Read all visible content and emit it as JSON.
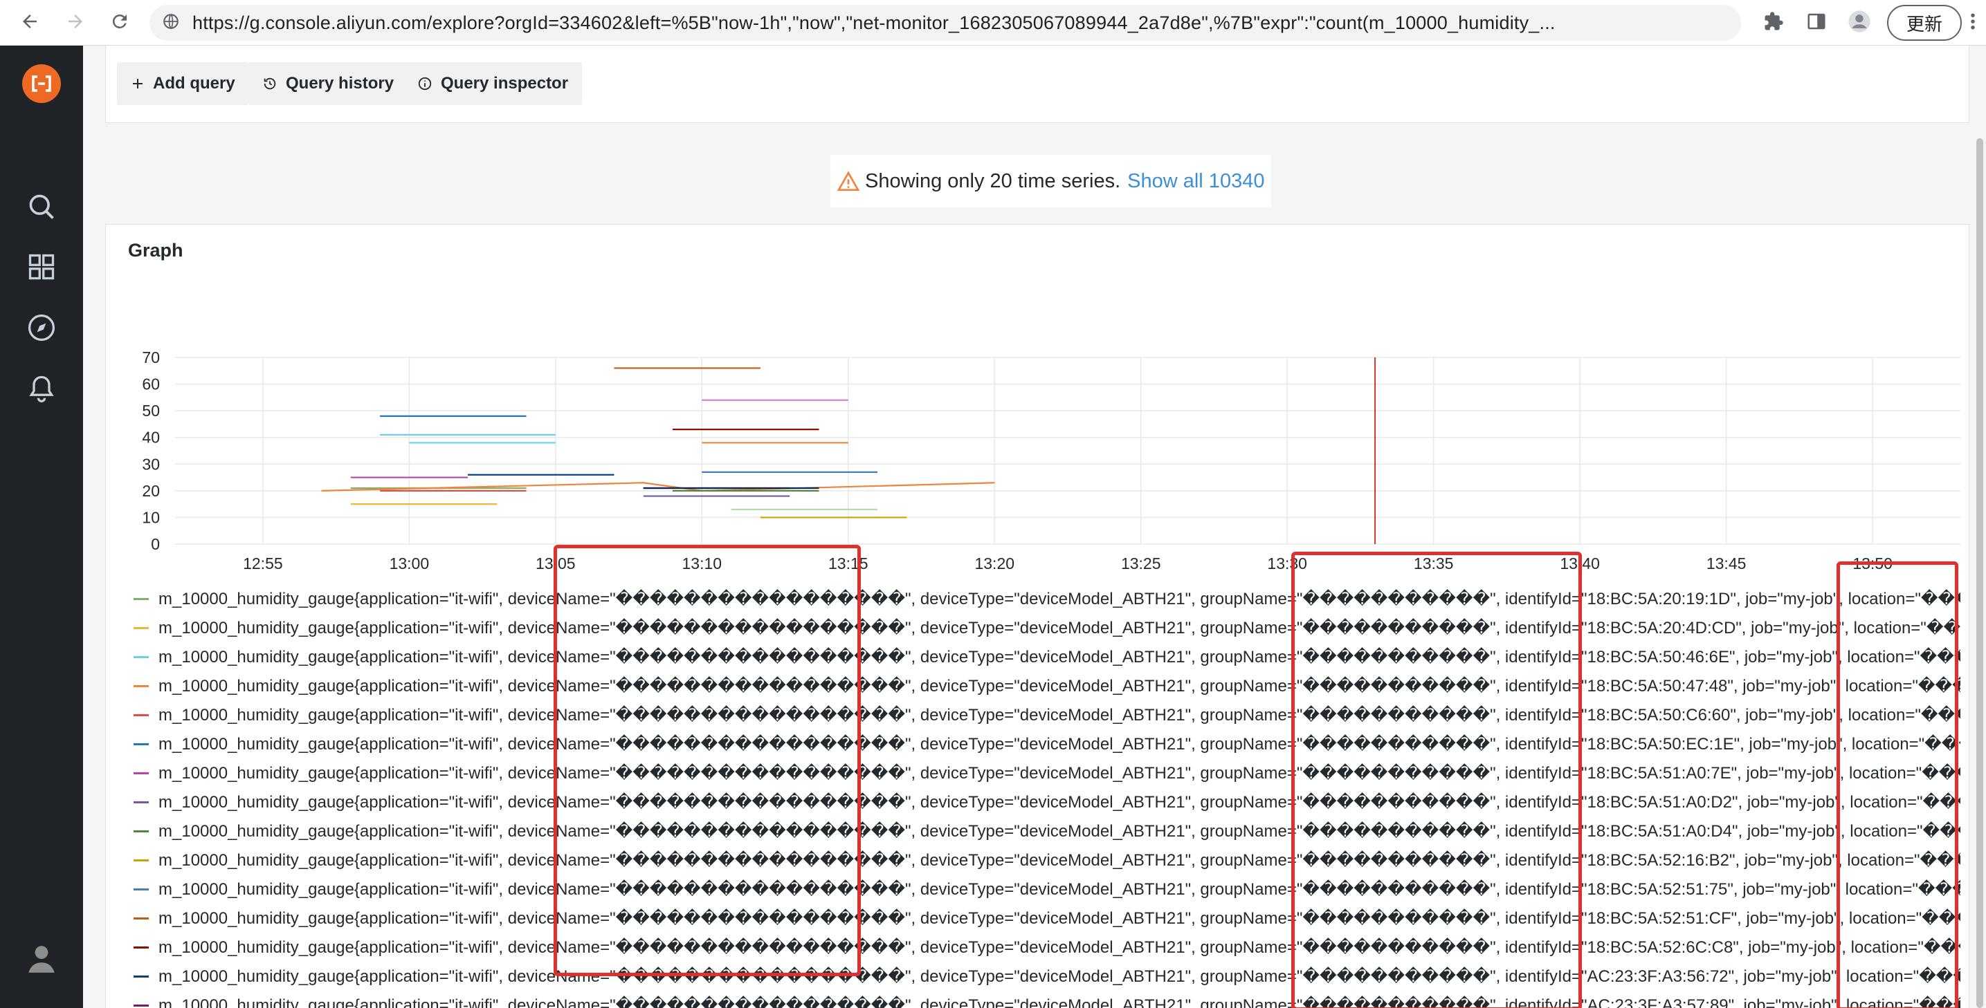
{
  "browser": {
    "url": "https://g.console.aliyun.com/explore?orgId=334602&left=%5B\"now-1h\",\"now\",\"net-monitor_1682305067089944_2a7d8e\",%7B\"expr\":\"count(m_10000_humidity_...",
    "update_label": "更新"
  },
  "toolbar": {
    "add_query": "Add query",
    "query_history": "Query history",
    "query_inspector": "Query inspector"
  },
  "warning": {
    "text": "Showing only 20 time series.",
    "link": "Show all 10340"
  },
  "panel": {
    "title": "Graph"
  },
  "colors": {
    "accent_red": "#e0302b",
    "link": "#3b8fd9",
    "sidebar_bg": "#1f2227",
    "logo": "#ee6a24"
  },
  "chart_data": {
    "type": "line",
    "xlabel": "",
    "ylabel": "",
    "ylim": [
      0,
      70
    ],
    "yticks": [
      "0",
      "10",
      "20",
      "30",
      "40",
      "50",
      "60",
      "70"
    ],
    "xlim": [
      "12:52",
      "13:53"
    ],
    "xticks": [
      "12:55",
      "13:00",
      "13:05",
      "13:10",
      "13:15",
      "13:20",
      "13:25",
      "13:30",
      "13:35",
      "13:40",
      "13:45",
      "13:50"
    ],
    "grid": true,
    "vertical_marker": {
      "x": "13:33",
      "color": "#c4392d"
    },
    "series": [
      {
        "color": "#7eb26d",
        "x": [
          "12:58",
          "13:04"
        ],
        "y": [
          21,
          21
        ]
      },
      {
        "color": "#eab839",
        "x": [
          "12:58",
          "13:03"
        ],
        "y": [
          15,
          15
        ]
      },
      {
        "color": "#6ed0e0",
        "x": [
          "12:59",
          "13:05"
        ],
        "y": [
          41,
          41
        ]
      },
      {
        "color": "#ef843c",
        "x": [
          "12:57",
          "13:08",
          "13:10",
          "13:20"
        ],
        "y": [
          20,
          23,
          20,
          23
        ]
      },
      {
        "color": "#e24d42",
        "x": [
          "12:59",
          "13:04"
        ],
        "y": [
          20,
          20
        ]
      },
      {
        "color": "#1f78c1",
        "x": [
          "12:59",
          "13:04"
        ],
        "y": [
          48,
          48
        ]
      },
      {
        "color": "#ba43a9",
        "x": [
          "12:58",
          "13:02"
        ],
        "y": [
          25,
          25
        ]
      },
      {
        "color": "#705da0",
        "x": [
          "13:08",
          "13:13"
        ],
        "y": [
          18,
          18
        ]
      },
      {
        "color": "#508642",
        "x": [
          "13:09",
          "13:14"
        ],
        "y": [
          20,
          20
        ]
      },
      {
        "color": "#cca300",
        "x": [
          "13:12",
          "13:17"
        ],
        "y": [
          10,
          10
        ]
      },
      {
        "color": "#447ebc",
        "x": [
          "13:10",
          "13:16"
        ],
        "y": [
          27,
          27
        ]
      },
      {
        "color": "#c15c17",
        "x": [
          "13:07",
          "13:12"
        ],
        "y": [
          66,
          66
        ]
      },
      {
        "color": "#890f02",
        "x": [
          "13:09",
          "13:14"
        ],
        "y": [
          43,
          43
        ]
      },
      {
        "color": "#0a437c",
        "x": [
          "13:02",
          "13:07"
        ],
        "y": [
          26,
          26
        ]
      },
      {
        "color": "#6d1f62",
        "x": [
          "13:08",
          "13:13"
        ],
        "y": [
          21,
          21
        ]
      },
      {
        "color": "#d683ce",
        "x": [
          "13:10",
          "13:15"
        ],
        "y": [
          54,
          54
        ]
      },
      {
        "color": "#ef843c",
        "x": [
          "13:10",
          "13:15"
        ],
        "y": [
          38,
          38
        ]
      },
      {
        "color": "#6ed0e0",
        "x": [
          "13:00",
          "13:05"
        ],
        "y": [
          38,
          38
        ]
      },
      {
        "color": "#b7dbab",
        "x": [
          "13:11",
          "13:16"
        ],
        "y": [
          13,
          13
        ]
      },
      {
        "color": "#052b51",
        "x": [
          "13:08",
          "13:14"
        ],
        "y": [
          21,
          21
        ]
      }
    ]
  },
  "legend": [
    {
      "color": "#7eb26d",
      "text": "m_10000_humidity_gauge{application=\"it-wifi\", deviceName=\"�����������������\", deviceType=\"deviceModel_ABTH21\", groupName=\"�����������\", identifyId=\"18:BC:5A:20:19:1D\", job=\"my-job\", location=\"���"
    },
    {
      "color": "#eab839",
      "text": "m_10000_humidity_gauge{application=\"it-wifi\", deviceName=\"�����������������\", deviceType=\"deviceModel_ABTH21\", groupName=\"�����������\", identifyId=\"18:BC:5A:20:4D:CD\", job=\"my-job\", location=\"���"
    },
    {
      "color": "#6ed0e0",
      "text": "m_10000_humidity_gauge{application=\"it-wifi\", deviceName=\"�����������������\", deviceType=\"deviceModel_ABTH21\", groupName=\"�����������\", identifyId=\"18:BC:5A:50:46:6E\", job=\"my-job\", location=\"���"
    },
    {
      "color": "#ef843c",
      "text": "m_10000_humidity_gauge{application=\"it-wifi\", deviceName=\"�����������������\", deviceType=\"deviceModel_ABTH21\", groupName=\"�����������\", identifyId=\"18:BC:5A:50:47:48\", job=\"my-job\", location=\"���"
    },
    {
      "color": "#e24d42",
      "text": "m_10000_humidity_gauge{application=\"it-wifi\", deviceName=\"�����������������\", deviceType=\"deviceModel_ABTH21\", groupName=\"�����������\", identifyId=\"18:BC:5A:50:C6:60\", job=\"my-job\", location=\"���"
    },
    {
      "color": "#1f78c1",
      "text": "m_10000_humidity_gauge{application=\"it-wifi\", deviceName=\"�����������������\", deviceType=\"deviceModel_ABTH21\", groupName=\"�����������\", identifyId=\"18:BC:5A:50:EC:1E\", job=\"my-job\", location=\"���"
    },
    {
      "color": "#ba43a9",
      "text": "m_10000_humidity_gauge{application=\"it-wifi\", deviceName=\"�����������������\", deviceType=\"deviceModel_ABTH21\", groupName=\"�����������\", identifyId=\"18:BC:5A:51:A0:7E\", job=\"my-job\", location=\"���"
    },
    {
      "color": "#705da0",
      "text": "m_10000_humidity_gauge{application=\"it-wifi\", deviceName=\"�����������������\", deviceType=\"deviceModel_ABTH21\", groupName=\"�����������\", identifyId=\"18:BC:5A:51:A0:D2\", job=\"my-job\", location=\"���"
    },
    {
      "color": "#508642",
      "text": "m_10000_humidity_gauge{application=\"it-wifi\", deviceName=\"�����������������\", deviceType=\"deviceModel_ABTH21\", groupName=\"�����������\", identifyId=\"18:BC:5A:51:A0:D4\", job=\"my-job\", location=\"���"
    },
    {
      "color": "#cca300",
      "text": "m_10000_humidity_gauge{application=\"it-wifi\", deviceName=\"�����������������\", deviceType=\"deviceModel_ABTH21\", groupName=\"�����������\", identifyId=\"18:BC:5A:52:16:B2\", job=\"my-job\", location=\"���"
    },
    {
      "color": "#447ebc",
      "text": "m_10000_humidity_gauge{application=\"it-wifi\", deviceName=\"�����������������\", deviceType=\"deviceModel_ABTH21\", groupName=\"�����������\", identifyId=\"18:BC:5A:52:51:75\", job=\"my-job\", location=\"���"
    },
    {
      "color": "#c15c17",
      "text": "m_10000_humidity_gauge{application=\"it-wifi\", deviceName=\"�����������������\", deviceType=\"deviceModel_ABTH21\", groupName=\"�����������\", identifyId=\"18:BC:5A:52:51:CF\", job=\"my-job\", location=\"���"
    },
    {
      "color": "#890f02",
      "text": "m_10000_humidity_gauge{application=\"it-wifi\", deviceName=\"�����������������\", deviceType=\"deviceModel_ABTH21\", groupName=\"�����������\", identifyId=\"18:BC:5A:52:6C:C8\", job=\"my-job\", location=\"���"
    },
    {
      "color": "#0a437c",
      "text": "m_10000_humidity_gauge{application=\"it-wifi\", deviceName=\"�����������������\", deviceType=\"deviceModel_ABTH21\", groupName=\"�����������\", identifyId=\"AC:23:3F:A3:56:72\", job=\"my-job\", location=\"���"
    },
    {
      "color": "#6d1f62",
      "text": "m_10000_humidity_gauge{application=\"it-wifi\", deviceName=\"�����������������\", deviceType=\"deviceModel_ABTH21\", groupName=\"�����������\", identifyId=\"AC:23:3F:A3:57:89\", job=\"my-job\", location=\"���"
    }
  ]
}
